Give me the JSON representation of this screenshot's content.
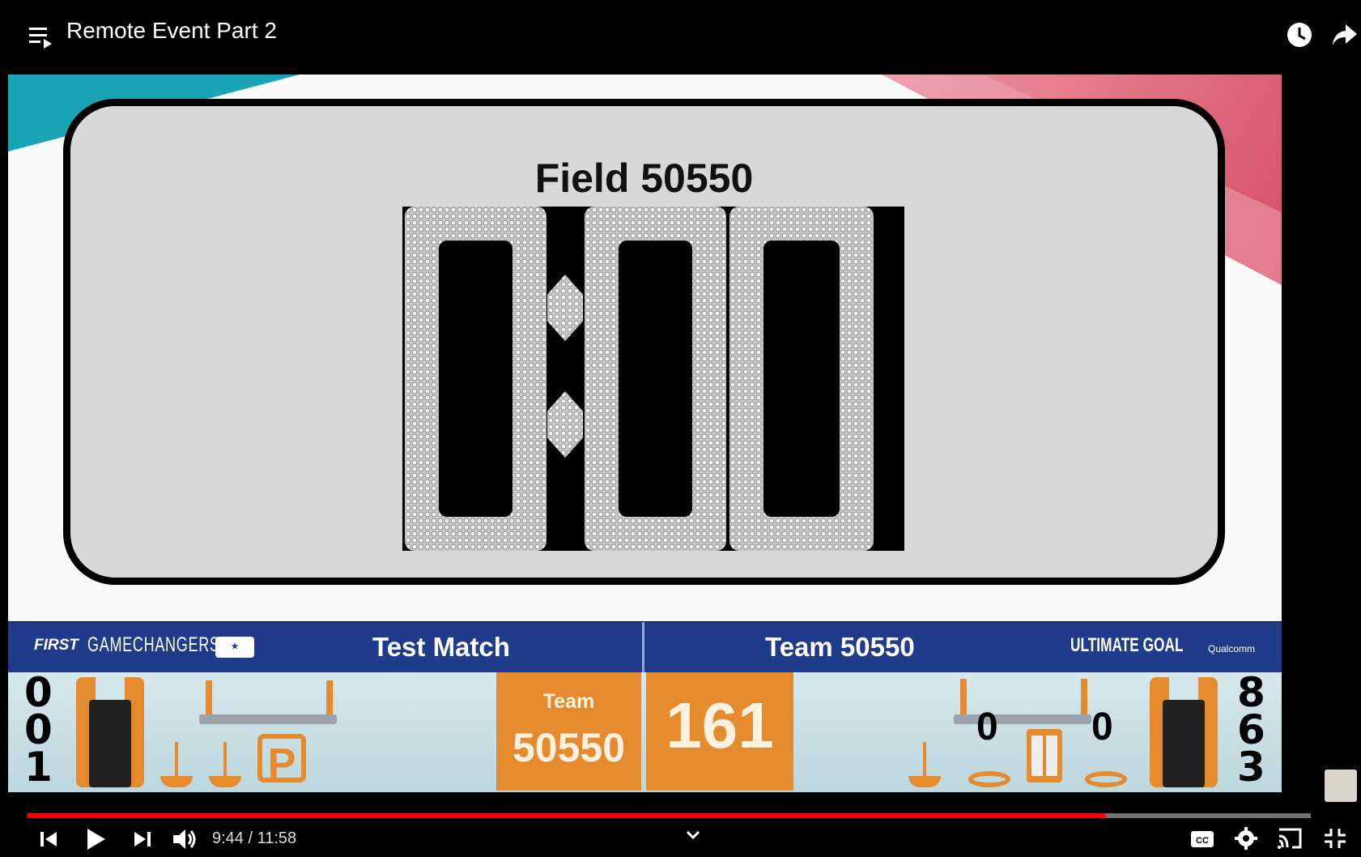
{
  "header": {
    "title": "Remote Event Part 2"
  },
  "display": {
    "field_title": "Field 50550",
    "timer": "0:00"
  },
  "scorebar": {
    "logo_first": "FIRST",
    "logo_game": "GAMECHANGERS",
    "match_title": "Test Match",
    "team_title": "Team 50550",
    "logo_game_name": "ULTIMATE GOAL",
    "logo_sponsor": "Qualcomm",
    "left_digits": [
      "0",
      "0",
      "1"
    ],
    "right_digits": [
      "8",
      "6",
      "3"
    ],
    "park_label": "P",
    "team_card_label": "Team",
    "team_card_number": "50550",
    "score": "161",
    "ring_count_left": "0",
    "ring_count_right": "0"
  },
  "player": {
    "time_display": "9:44 / 11:58",
    "progress": 0.84,
    "icons": [
      "playlist-icon",
      "clock-icon",
      "share-icon",
      "previous-icon",
      "play-icon",
      "next-icon",
      "volume-icon",
      "chevron-down-icon",
      "captions-icon",
      "settings-icon",
      "cast-icon",
      "exit-fullscreen-icon"
    ]
  },
  "colors": {
    "accent": "#e58b2e",
    "bar_blue": "#1f3b8a",
    "progress": "#ff0000"
  }
}
